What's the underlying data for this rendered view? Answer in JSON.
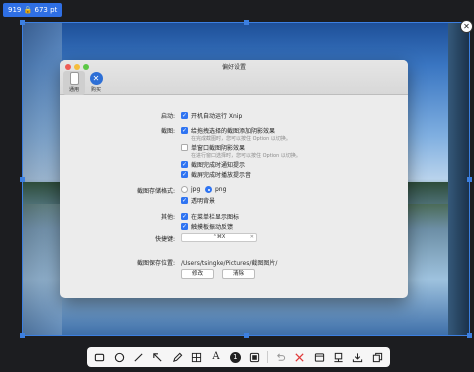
{
  "selection": {
    "dimensions": "919 🔒 673  pt"
  },
  "prefs": {
    "title": "偏好设置",
    "tabs": [
      {
        "label": "通用",
        "icon": "phone-icon"
      },
      {
        "label": "购买",
        "icon": "tools-icon"
      }
    ],
    "startup": {
      "label": "启动:",
      "option": "开机自动运行 Xnip"
    },
    "capture": {
      "label": "截图:",
      "opt1": "给拖拽选择的截图添加阴影效果",
      "opt1_sub": "在完成截图时，您可以按住 Option 以切换。",
      "opt2": "单窗口截图阴影效果",
      "opt2_sub": "在进行窗口选择时，您可以按住 Option 以切换。",
      "opt3": "截图完成时通知提示",
      "opt4": "截屏完成时播放提示音"
    },
    "format": {
      "label": "截图存储格式:",
      "jpg": "jpg",
      "png": "png",
      "transparent": "透明背景"
    },
    "other": {
      "label": "其他:",
      "menubar": "在菜单栏显示图标",
      "haptic": "触摸板振动反馈"
    },
    "shortcut": {
      "label": "快捷键:",
      "value": "⌃⌘X"
    },
    "save": {
      "label": "截图保存位置:",
      "path": "/Users/tsingke/Pictures/截图图片/",
      "modify": "修改",
      "clear": "清除"
    }
  },
  "toolbar": {
    "tools": [
      "rectangle-tool-icon",
      "ellipse-tool-icon",
      "line-tool-icon",
      "arrow-tool-icon",
      "pencil-tool-icon",
      "mosaic-tool-icon",
      "text-tool-icon",
      "step-number-tool-icon",
      "highlight-tool-icon",
      "undo-icon",
      "cancel-icon",
      "window-capture-icon",
      "pin-icon",
      "save-icon",
      "copy-icon"
    ],
    "text_glyph": "A",
    "step_glyph": "1"
  }
}
